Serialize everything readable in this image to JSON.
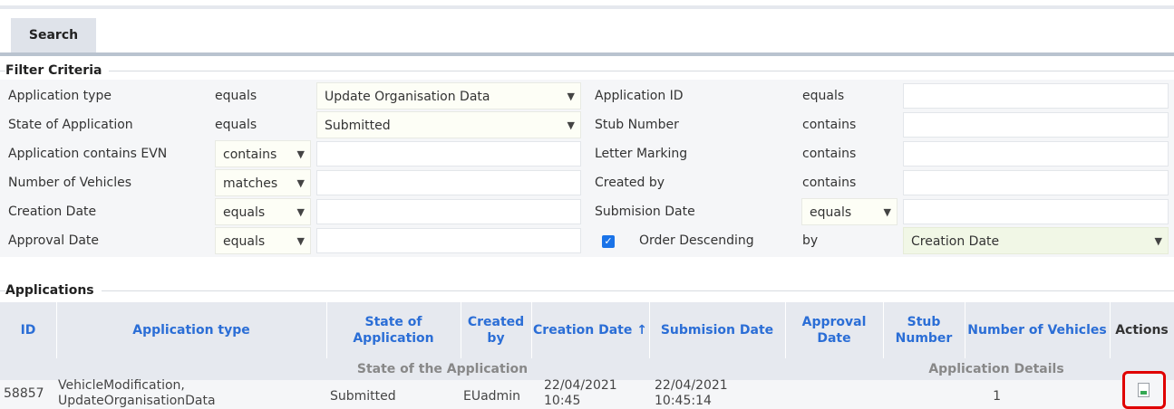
{
  "tabs": [
    {
      "label": "Search"
    }
  ],
  "filter": {
    "legend": "Filter Criteria",
    "left": [
      {
        "label": "Application type",
        "operator": "equals",
        "value": "Update Organisation Data"
      },
      {
        "label": "State of Application",
        "operator": "equals",
        "value": "Submitted"
      },
      {
        "label": "Application contains EVN",
        "operator": "contains",
        "value": ""
      },
      {
        "label": "Number of Vehicles",
        "operator": "matches",
        "value": ""
      },
      {
        "label": "Creation Date",
        "operator": "equals",
        "value": ""
      },
      {
        "label": "Approval Date",
        "operator": "equals",
        "value": ""
      }
    ],
    "right": [
      {
        "label": "Application ID",
        "operator": "equals",
        "value": ""
      },
      {
        "label": "Stub Number",
        "operator": "contains",
        "value": ""
      },
      {
        "label": "Letter Marking",
        "operator": "contains",
        "value": ""
      },
      {
        "label": "Created by",
        "operator": "contains",
        "value": ""
      },
      {
        "label": "Submision Date",
        "operator": "equals",
        "value": ""
      }
    ],
    "order": {
      "checked": true,
      "label": "Order Descending",
      "by_label": "by",
      "by_value": "Creation Date"
    }
  },
  "applications": {
    "legend": "Applications",
    "columns": [
      "ID",
      "Application type",
      "State of Application",
      "Created by",
      "Creation Date ↑",
      "Submision Date",
      "Approval Date",
      "Stub Number",
      "Number of Vehicles",
      "Actions"
    ],
    "groups": {
      "state": "State of the Application",
      "details": "Application Details"
    },
    "rows": [
      {
        "id": "58857",
        "type_line1": "VehicleModification,",
        "type_line2": "UpdateOrganisationData",
        "state": "Submitted",
        "created_by": "EUadmin",
        "creation_date_line1": "22/04/2021",
        "creation_date_line2": "10:45",
        "submision_date_line1": "22/04/2021",
        "submision_date_line2": "10:45:14",
        "approval_date": "",
        "stub_number": "",
        "number_of_vehicles": "1",
        "action_icon": "document-icon"
      }
    ]
  },
  "colors": {
    "link": "#2b6ed6",
    "highlight": "#e00000",
    "checkbox": "#1a73e8"
  }
}
